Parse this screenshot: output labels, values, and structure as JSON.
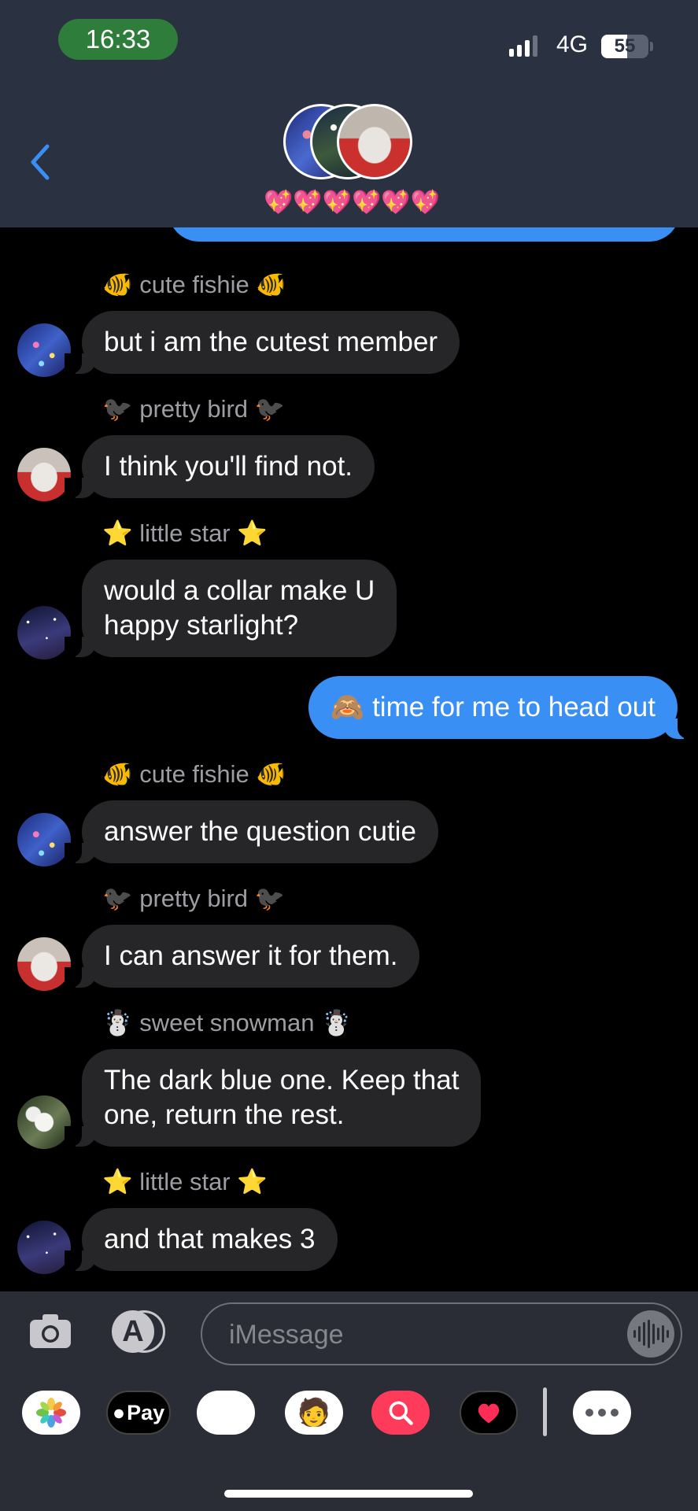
{
  "status_bar": {
    "time": "16:33",
    "network": "4G",
    "battery_level": "55",
    "signal_bars": 3,
    "signal_bars_total": 4
  },
  "header": {
    "group_name": "💖💖💖💖💖💖",
    "back_icon": "chevron-left-icon"
  },
  "conversation": [
    {
      "type": "sender",
      "text": "🐠 cute fishie 🐠"
    },
    {
      "type": "incoming",
      "avatar": "fish",
      "text": "but i am the cutest member"
    },
    {
      "type": "sender",
      "text": "🐦‍⬛ pretty bird 🐦‍⬛"
    },
    {
      "type": "incoming",
      "avatar": "bird",
      "text": "I think you'll find not."
    },
    {
      "type": "sender",
      "text": "⭐ little star ⭐"
    },
    {
      "type": "incoming",
      "avatar": "star",
      "text_lines": [
        "would a collar make U",
        "happy starlight?"
      ]
    },
    {
      "type": "outgoing",
      "text": "🙈 time for me to head out"
    },
    {
      "type": "sender",
      "text": "🐠 cute fishie 🐠"
    },
    {
      "type": "incoming",
      "avatar": "fish",
      "text": "answer the question cutie"
    },
    {
      "type": "sender",
      "text": "🐦‍⬛ pretty bird 🐦‍⬛"
    },
    {
      "type": "incoming",
      "avatar": "bird",
      "text": "I can answer it for them."
    },
    {
      "type": "sender",
      "text": "☃️ sweet snowman ☃️"
    },
    {
      "type": "incoming",
      "avatar": "flower",
      "text_lines": [
        "The dark blue one. Keep that",
        "one, return the rest."
      ]
    },
    {
      "type": "sender",
      "text": "⭐ little star ⭐"
    },
    {
      "type": "incoming",
      "avatar": "star",
      "text": "and that makes 3"
    }
  ],
  "composer": {
    "placeholder": "iMessage",
    "camera_icon": "camera-icon",
    "apps_icon": "app-store-icon",
    "audio_icon": "audio-waveform-icon"
  },
  "app_drawer": {
    "apple_pay_label": "Pay",
    "apps": [
      "photos-icon",
      "apple-pay-icon",
      "monkey-emoji-icon",
      "memoji-icon",
      "search-images-icon",
      "digital-touch-icon",
      "more-icon"
    ]
  },
  "colors": {
    "header_bg": "#2a3140",
    "incoming_bubble": "#262628",
    "outgoing_bubble": "#3a8ff5",
    "time_pill": "#2f7d3a"
  }
}
